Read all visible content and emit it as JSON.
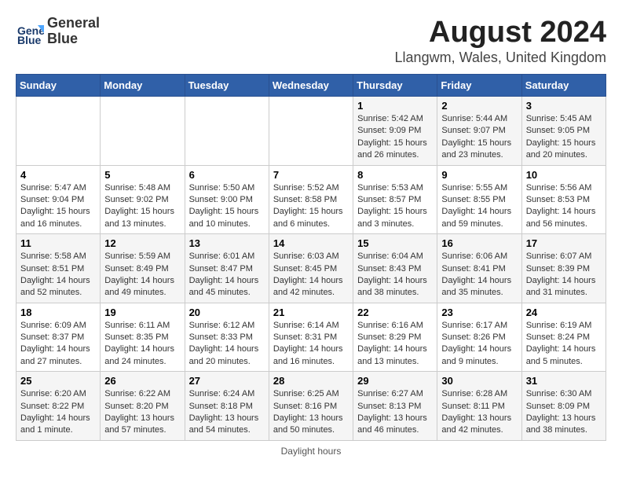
{
  "header": {
    "logo_line1": "General",
    "logo_line2": "Blue",
    "title": "August 2024",
    "subtitle": "Llangwm, Wales, United Kingdom"
  },
  "footer": {
    "text": "Daylight hours"
  },
  "columns": [
    "Sunday",
    "Monday",
    "Tuesday",
    "Wednesday",
    "Thursday",
    "Friday",
    "Saturday"
  ],
  "weeks": [
    [
      {
        "day": "",
        "info": ""
      },
      {
        "day": "",
        "info": ""
      },
      {
        "day": "",
        "info": ""
      },
      {
        "day": "",
        "info": ""
      },
      {
        "day": "1",
        "info": "Sunrise: 5:42 AM\nSunset: 9:09 PM\nDaylight: 15 hours\nand 26 minutes."
      },
      {
        "day": "2",
        "info": "Sunrise: 5:44 AM\nSunset: 9:07 PM\nDaylight: 15 hours\nand 23 minutes."
      },
      {
        "day": "3",
        "info": "Sunrise: 5:45 AM\nSunset: 9:05 PM\nDaylight: 15 hours\nand 20 minutes."
      }
    ],
    [
      {
        "day": "4",
        "info": "Sunrise: 5:47 AM\nSunset: 9:04 PM\nDaylight: 15 hours\nand 16 minutes."
      },
      {
        "day": "5",
        "info": "Sunrise: 5:48 AM\nSunset: 9:02 PM\nDaylight: 15 hours\nand 13 minutes."
      },
      {
        "day": "6",
        "info": "Sunrise: 5:50 AM\nSunset: 9:00 PM\nDaylight: 15 hours\nand 10 minutes."
      },
      {
        "day": "7",
        "info": "Sunrise: 5:52 AM\nSunset: 8:58 PM\nDaylight: 15 hours\nand 6 minutes."
      },
      {
        "day": "8",
        "info": "Sunrise: 5:53 AM\nSunset: 8:57 PM\nDaylight: 15 hours\nand 3 minutes."
      },
      {
        "day": "9",
        "info": "Sunrise: 5:55 AM\nSunset: 8:55 PM\nDaylight: 14 hours\nand 59 minutes."
      },
      {
        "day": "10",
        "info": "Sunrise: 5:56 AM\nSunset: 8:53 PM\nDaylight: 14 hours\nand 56 minutes."
      }
    ],
    [
      {
        "day": "11",
        "info": "Sunrise: 5:58 AM\nSunset: 8:51 PM\nDaylight: 14 hours\nand 52 minutes."
      },
      {
        "day": "12",
        "info": "Sunrise: 5:59 AM\nSunset: 8:49 PM\nDaylight: 14 hours\nand 49 minutes."
      },
      {
        "day": "13",
        "info": "Sunrise: 6:01 AM\nSunset: 8:47 PM\nDaylight: 14 hours\nand 45 minutes."
      },
      {
        "day": "14",
        "info": "Sunrise: 6:03 AM\nSunset: 8:45 PM\nDaylight: 14 hours\nand 42 minutes."
      },
      {
        "day": "15",
        "info": "Sunrise: 6:04 AM\nSunset: 8:43 PM\nDaylight: 14 hours\nand 38 minutes."
      },
      {
        "day": "16",
        "info": "Sunrise: 6:06 AM\nSunset: 8:41 PM\nDaylight: 14 hours\nand 35 minutes."
      },
      {
        "day": "17",
        "info": "Sunrise: 6:07 AM\nSunset: 8:39 PM\nDaylight: 14 hours\nand 31 minutes."
      }
    ],
    [
      {
        "day": "18",
        "info": "Sunrise: 6:09 AM\nSunset: 8:37 PM\nDaylight: 14 hours\nand 27 minutes."
      },
      {
        "day": "19",
        "info": "Sunrise: 6:11 AM\nSunset: 8:35 PM\nDaylight: 14 hours\nand 24 minutes."
      },
      {
        "day": "20",
        "info": "Sunrise: 6:12 AM\nSunset: 8:33 PM\nDaylight: 14 hours\nand 20 minutes."
      },
      {
        "day": "21",
        "info": "Sunrise: 6:14 AM\nSunset: 8:31 PM\nDaylight: 14 hours\nand 16 minutes."
      },
      {
        "day": "22",
        "info": "Sunrise: 6:16 AM\nSunset: 8:29 PM\nDaylight: 14 hours\nand 13 minutes."
      },
      {
        "day": "23",
        "info": "Sunrise: 6:17 AM\nSunset: 8:26 PM\nDaylight: 14 hours\nand 9 minutes."
      },
      {
        "day": "24",
        "info": "Sunrise: 6:19 AM\nSunset: 8:24 PM\nDaylight: 14 hours\nand 5 minutes."
      }
    ],
    [
      {
        "day": "25",
        "info": "Sunrise: 6:20 AM\nSunset: 8:22 PM\nDaylight: 14 hours\nand 1 minute."
      },
      {
        "day": "26",
        "info": "Sunrise: 6:22 AM\nSunset: 8:20 PM\nDaylight: 13 hours\nand 57 minutes."
      },
      {
        "day": "27",
        "info": "Sunrise: 6:24 AM\nSunset: 8:18 PM\nDaylight: 13 hours\nand 54 minutes."
      },
      {
        "day": "28",
        "info": "Sunrise: 6:25 AM\nSunset: 8:16 PM\nDaylight: 13 hours\nand 50 minutes."
      },
      {
        "day": "29",
        "info": "Sunrise: 6:27 AM\nSunset: 8:13 PM\nDaylight: 13 hours\nand 46 minutes."
      },
      {
        "day": "30",
        "info": "Sunrise: 6:28 AM\nSunset: 8:11 PM\nDaylight: 13 hours\nand 42 minutes."
      },
      {
        "day": "31",
        "info": "Sunrise: 6:30 AM\nSunset: 8:09 PM\nDaylight: 13 hours\nand 38 minutes."
      }
    ]
  ]
}
